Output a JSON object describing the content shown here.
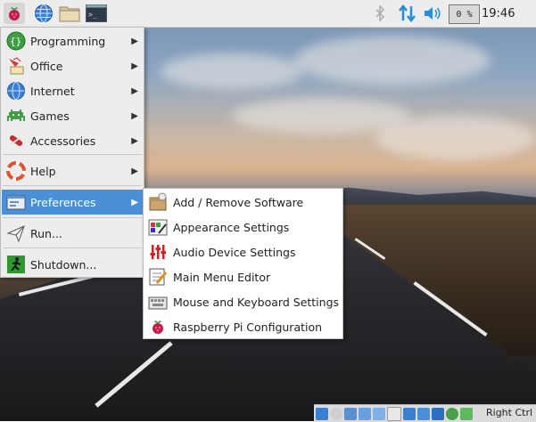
{
  "taskbar": {
    "launchers": [
      {
        "icon": "raspberry-menu-icon"
      },
      {
        "icon": "globe-browser-icon"
      },
      {
        "icon": "folder-icon"
      },
      {
        "icon": "terminal-icon"
      }
    ],
    "tray": {
      "bluetooth_icon": "bluetooth-icon",
      "network_icon": "network-arrows-icon",
      "volume_icon": "volume-icon",
      "cpu_usage": "0 %",
      "clock": "19:46"
    }
  },
  "main_menu": {
    "items": [
      {
        "label": "Programming",
        "icon": "programming-icon",
        "has_submenu": true
      },
      {
        "label": "Office",
        "icon": "office-icon",
        "has_submenu": true
      },
      {
        "label": "Internet",
        "icon": "internet-icon",
        "has_submenu": true
      },
      {
        "label": "Games",
        "icon": "games-icon",
        "has_submenu": true
      },
      {
        "label": "Accessories",
        "icon": "accessories-icon",
        "has_submenu": true
      },
      {
        "label": "Help",
        "icon": "help-icon",
        "has_submenu": true
      },
      {
        "label": "Preferences",
        "icon": "preferences-icon",
        "has_submenu": true,
        "highlighted": true
      },
      {
        "label": "Run...",
        "icon": "run-icon",
        "has_submenu": false
      },
      {
        "label": "Shutdown...",
        "icon": "shutdown-icon",
        "has_submenu": false
      }
    ]
  },
  "preferences_submenu": {
    "items": [
      {
        "label": "Add / Remove Software",
        "icon": "package-icon"
      },
      {
        "label": "Appearance Settings",
        "icon": "appearance-icon"
      },
      {
        "label": "Audio Device Settings",
        "icon": "audio-settings-icon"
      },
      {
        "label": "Main Menu Editor",
        "icon": "menu-editor-icon"
      },
      {
        "label": "Mouse and Keyboard Settings",
        "icon": "keyboard-icon"
      },
      {
        "label": "Raspberry Pi Configuration",
        "icon": "raspberry-icon"
      }
    ]
  },
  "vm_statusbar": {
    "host_key": "Right Ctrl"
  },
  "colors": {
    "highlight": "#4a90d9",
    "taskbar_bg": "#ededed",
    "tray_accent": "#2a8fd8"
  }
}
